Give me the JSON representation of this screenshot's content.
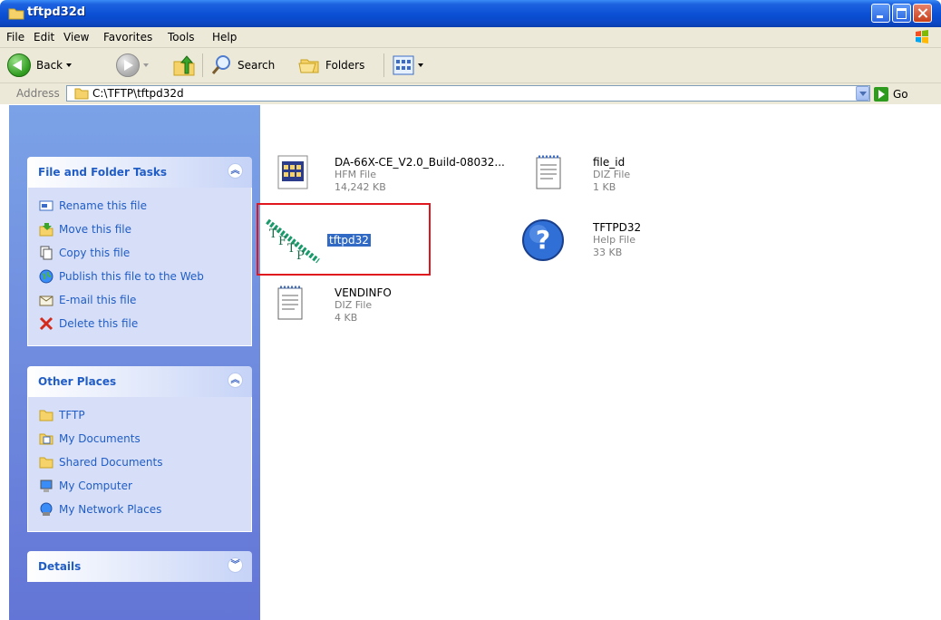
{
  "window": {
    "title": "tftpd32d"
  },
  "menubar": {
    "items": [
      "File",
      "Edit",
      "View",
      "Favorites",
      "Tools",
      "Help"
    ]
  },
  "toolbar": {
    "back_label": "Back",
    "search_label": "Search",
    "folders_label": "Folders"
  },
  "address": {
    "label": "Address",
    "path": "C:\\TFTP\\tftpd32d",
    "go_label": "Go"
  },
  "panels": {
    "file_tasks": {
      "title": "File and Folder Tasks",
      "items": [
        {
          "label": "Rename this file",
          "icon": "rename-icon"
        },
        {
          "label": "Move this file",
          "icon": "move-icon"
        },
        {
          "label": "Copy this file",
          "icon": "copy-icon"
        },
        {
          "label": "Publish this file to the Web",
          "icon": "publish-web-icon"
        },
        {
          "label": "E-mail this file",
          "icon": "email-icon"
        },
        {
          "label": "Delete this file",
          "icon": "delete-icon"
        }
      ]
    },
    "other_places": {
      "title": "Other Places",
      "items": [
        {
          "label": "TFTP",
          "icon": "folder-icon"
        },
        {
          "label": "My Documents",
          "icon": "my-documents-icon"
        },
        {
          "label": "Shared Documents",
          "icon": "folder-icon"
        },
        {
          "label": "My Computer",
          "icon": "my-computer-icon"
        },
        {
          "label": "My Network Places",
          "icon": "network-places-icon"
        }
      ]
    },
    "details": {
      "title": "Details"
    }
  },
  "files": [
    {
      "name": "DA-66X-CE_V2.0_Build-08032...",
      "type": "HFM File",
      "size": "14,242 KB",
      "icon": "hfm-file-icon"
    },
    {
      "name": "file_id",
      "type": "DIZ File",
      "size": "1 KB",
      "icon": "notepad-file-icon"
    },
    {
      "name": "tftpd32",
      "type": "",
      "size": "",
      "icon": "tftp-app-icon",
      "selected": true
    },
    {
      "name": "TFTPD32",
      "type": "Help File",
      "size": "33 KB",
      "icon": "help-file-icon"
    },
    {
      "name": "VENDINFO",
      "type": "DIZ File",
      "size": "4 KB",
      "icon": "notepad-file-icon"
    }
  ],
  "colors": {
    "title_bar": "#0a4fd4",
    "task_link": "#215dc6",
    "selection": "#316ac5",
    "annotation_box": "#e0171e"
  }
}
